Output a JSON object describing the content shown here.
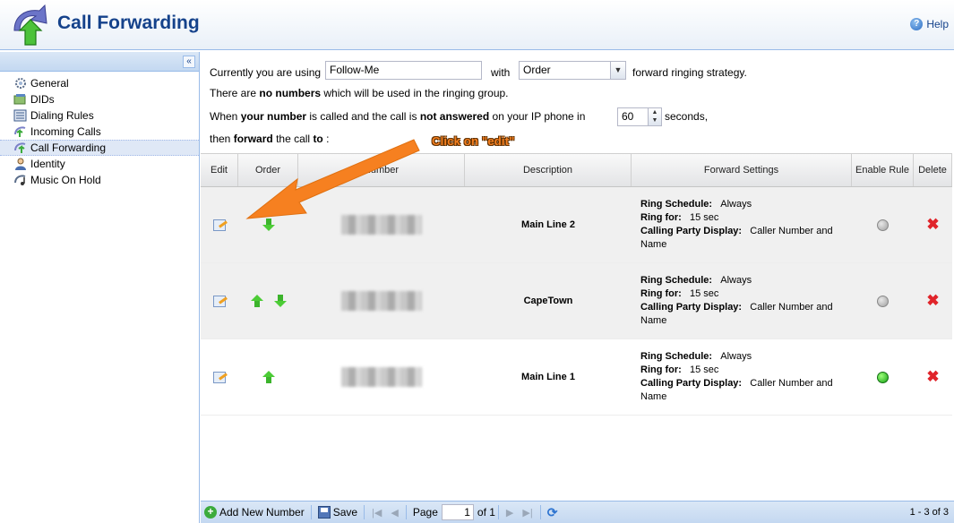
{
  "header": {
    "title": "Call Forwarding",
    "help_label": "Help"
  },
  "sidebar": {
    "items": [
      {
        "label": "General",
        "icon": "gear-icon",
        "active": false
      },
      {
        "label": "DIDs",
        "icon": "dids-icon",
        "active": false
      },
      {
        "label": "Dialing Rules",
        "icon": "dialing-rules-icon",
        "active": false
      },
      {
        "label": "Incoming Calls",
        "icon": "incoming-calls-icon",
        "active": false
      },
      {
        "label": "Call Forwarding",
        "icon": "call-forwarding-icon",
        "active": true
      },
      {
        "label": "Identity",
        "icon": "identity-icon",
        "active": false
      },
      {
        "label": "Music On Hold",
        "icon": "music-on-hold-icon",
        "active": false
      }
    ]
  },
  "form": {
    "line1_prefix": "Currently you are using",
    "strategy_value": "Follow-Me",
    "with_label": "with",
    "order_value": "Order",
    "line1_suffix": "forward ringing strategy.",
    "line2_a": "There are",
    "line2_b": "no numbers",
    "line2_c": "which will be used in the ringing group.",
    "line3_a": "When",
    "line3_b": "your number",
    "line3_c": "is called and the call is",
    "line3_d": "not answered",
    "line3_e": "on your IP phone in",
    "seconds_value": "60",
    "line3_f": "seconds,",
    "line4_a": "then",
    "line4_b": "forward",
    "line4_c": "the call",
    "line4_d": "to",
    "line4_e": ":"
  },
  "annotation": {
    "text": "Click on \"edit\"",
    "color": "#f68020"
  },
  "grid": {
    "columns": {
      "edit": "Edit",
      "order": "Order",
      "number": "Number",
      "description": "Description",
      "forward": "Forward Settings",
      "enable": "Enable Rule",
      "delete": "Delete"
    },
    "forward_labels": {
      "schedule": "Ring Schedule:",
      "ring_for": "Ring for:",
      "display": "Calling Party Display:"
    },
    "rows": [
      {
        "description": "Main Line 2",
        "schedule": "Always",
        "ring_for": "15 sec",
        "display": "Caller Number and Name",
        "enabled": false,
        "can_up": false,
        "can_down": true
      },
      {
        "description": "CapeTown",
        "schedule": "Always",
        "ring_for": "15 sec",
        "display": "Caller Number and Name",
        "enabled": false,
        "can_up": true,
        "can_down": true
      },
      {
        "description": "Main Line 1",
        "schedule": "Always",
        "ring_for": "15 sec",
        "display": "Caller Number and Name",
        "enabled": true,
        "can_up": true,
        "can_down": false
      }
    ]
  },
  "toolbar": {
    "add_label": "Add New Number",
    "save_label": "Save",
    "page_label": "Page",
    "page_value": "1",
    "of_label": "of 1",
    "range_label": "1 - 3 of 3"
  },
  "colors": {
    "enabled": "#22bb22",
    "disabled": "#b0b0b0",
    "delete": "#e0242a",
    "accent": "#15428b"
  }
}
